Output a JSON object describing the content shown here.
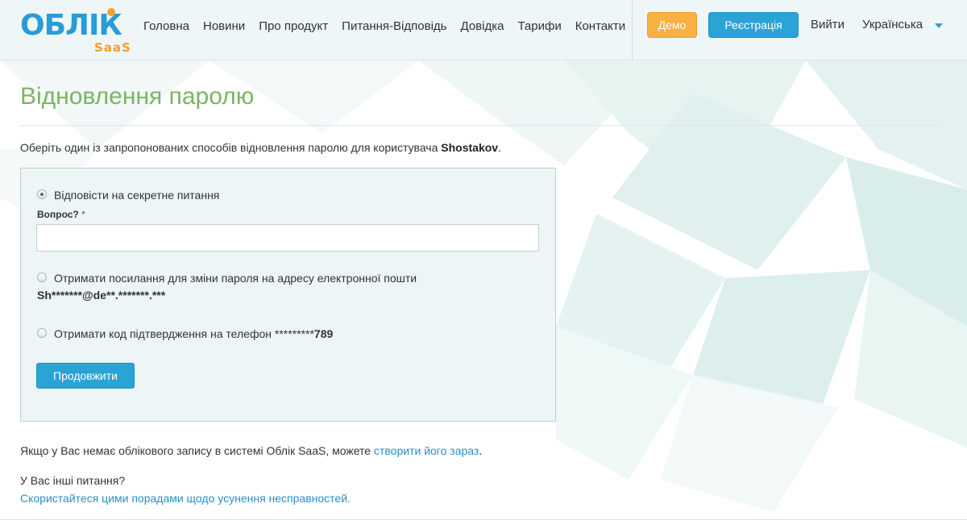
{
  "header": {
    "logo_main": "ОБЛІК",
    "logo_sub": "SaaS",
    "nav": [
      "Головна",
      "Новини",
      "Про продукт",
      "Питання-Відповідь",
      "Довідка",
      "Тарифи",
      "Контакти"
    ],
    "demo_label": "Демо",
    "register_label": "Реєстрація",
    "logout_label": "Вийти",
    "language": "Українська"
  },
  "page": {
    "title": "Відновлення паролю",
    "intro_prefix": "Оберіть один із запропонованих способів відновлення паролю для користувача ",
    "username": "Shostakov",
    "intro_suffix": "."
  },
  "form": {
    "option_secret": "Відповісти на секретне питання",
    "question_label": "Вопрос?",
    "required_mark": "*",
    "question_value": "",
    "option_email": "Отримати посилання для зміни пароля на адресу електронної пошти",
    "email_masked": "Sh*******@de**.*******.***",
    "option_phone_prefix": "Отримати код підтвердження на телефон *********",
    "phone_tail": "789",
    "continue_label": "Продовжити"
  },
  "footer": {
    "no_account_prefix": "Якщо у Вас немає облікового запису в системі Облік SaaS, можете ",
    "create_link": "створити його зараз",
    "no_account_suffix": ".",
    "other_questions": "У Вас інші питання?",
    "tips_link": "Скористайтеся цими порадами щодо усунення несправностей",
    "tips_suffix": "."
  },
  "colors": {
    "accent_blue": "#2aa3d6",
    "accent_orange": "#f8b040",
    "title_green": "#7bb661",
    "link_blue": "#2a8fc8"
  }
}
